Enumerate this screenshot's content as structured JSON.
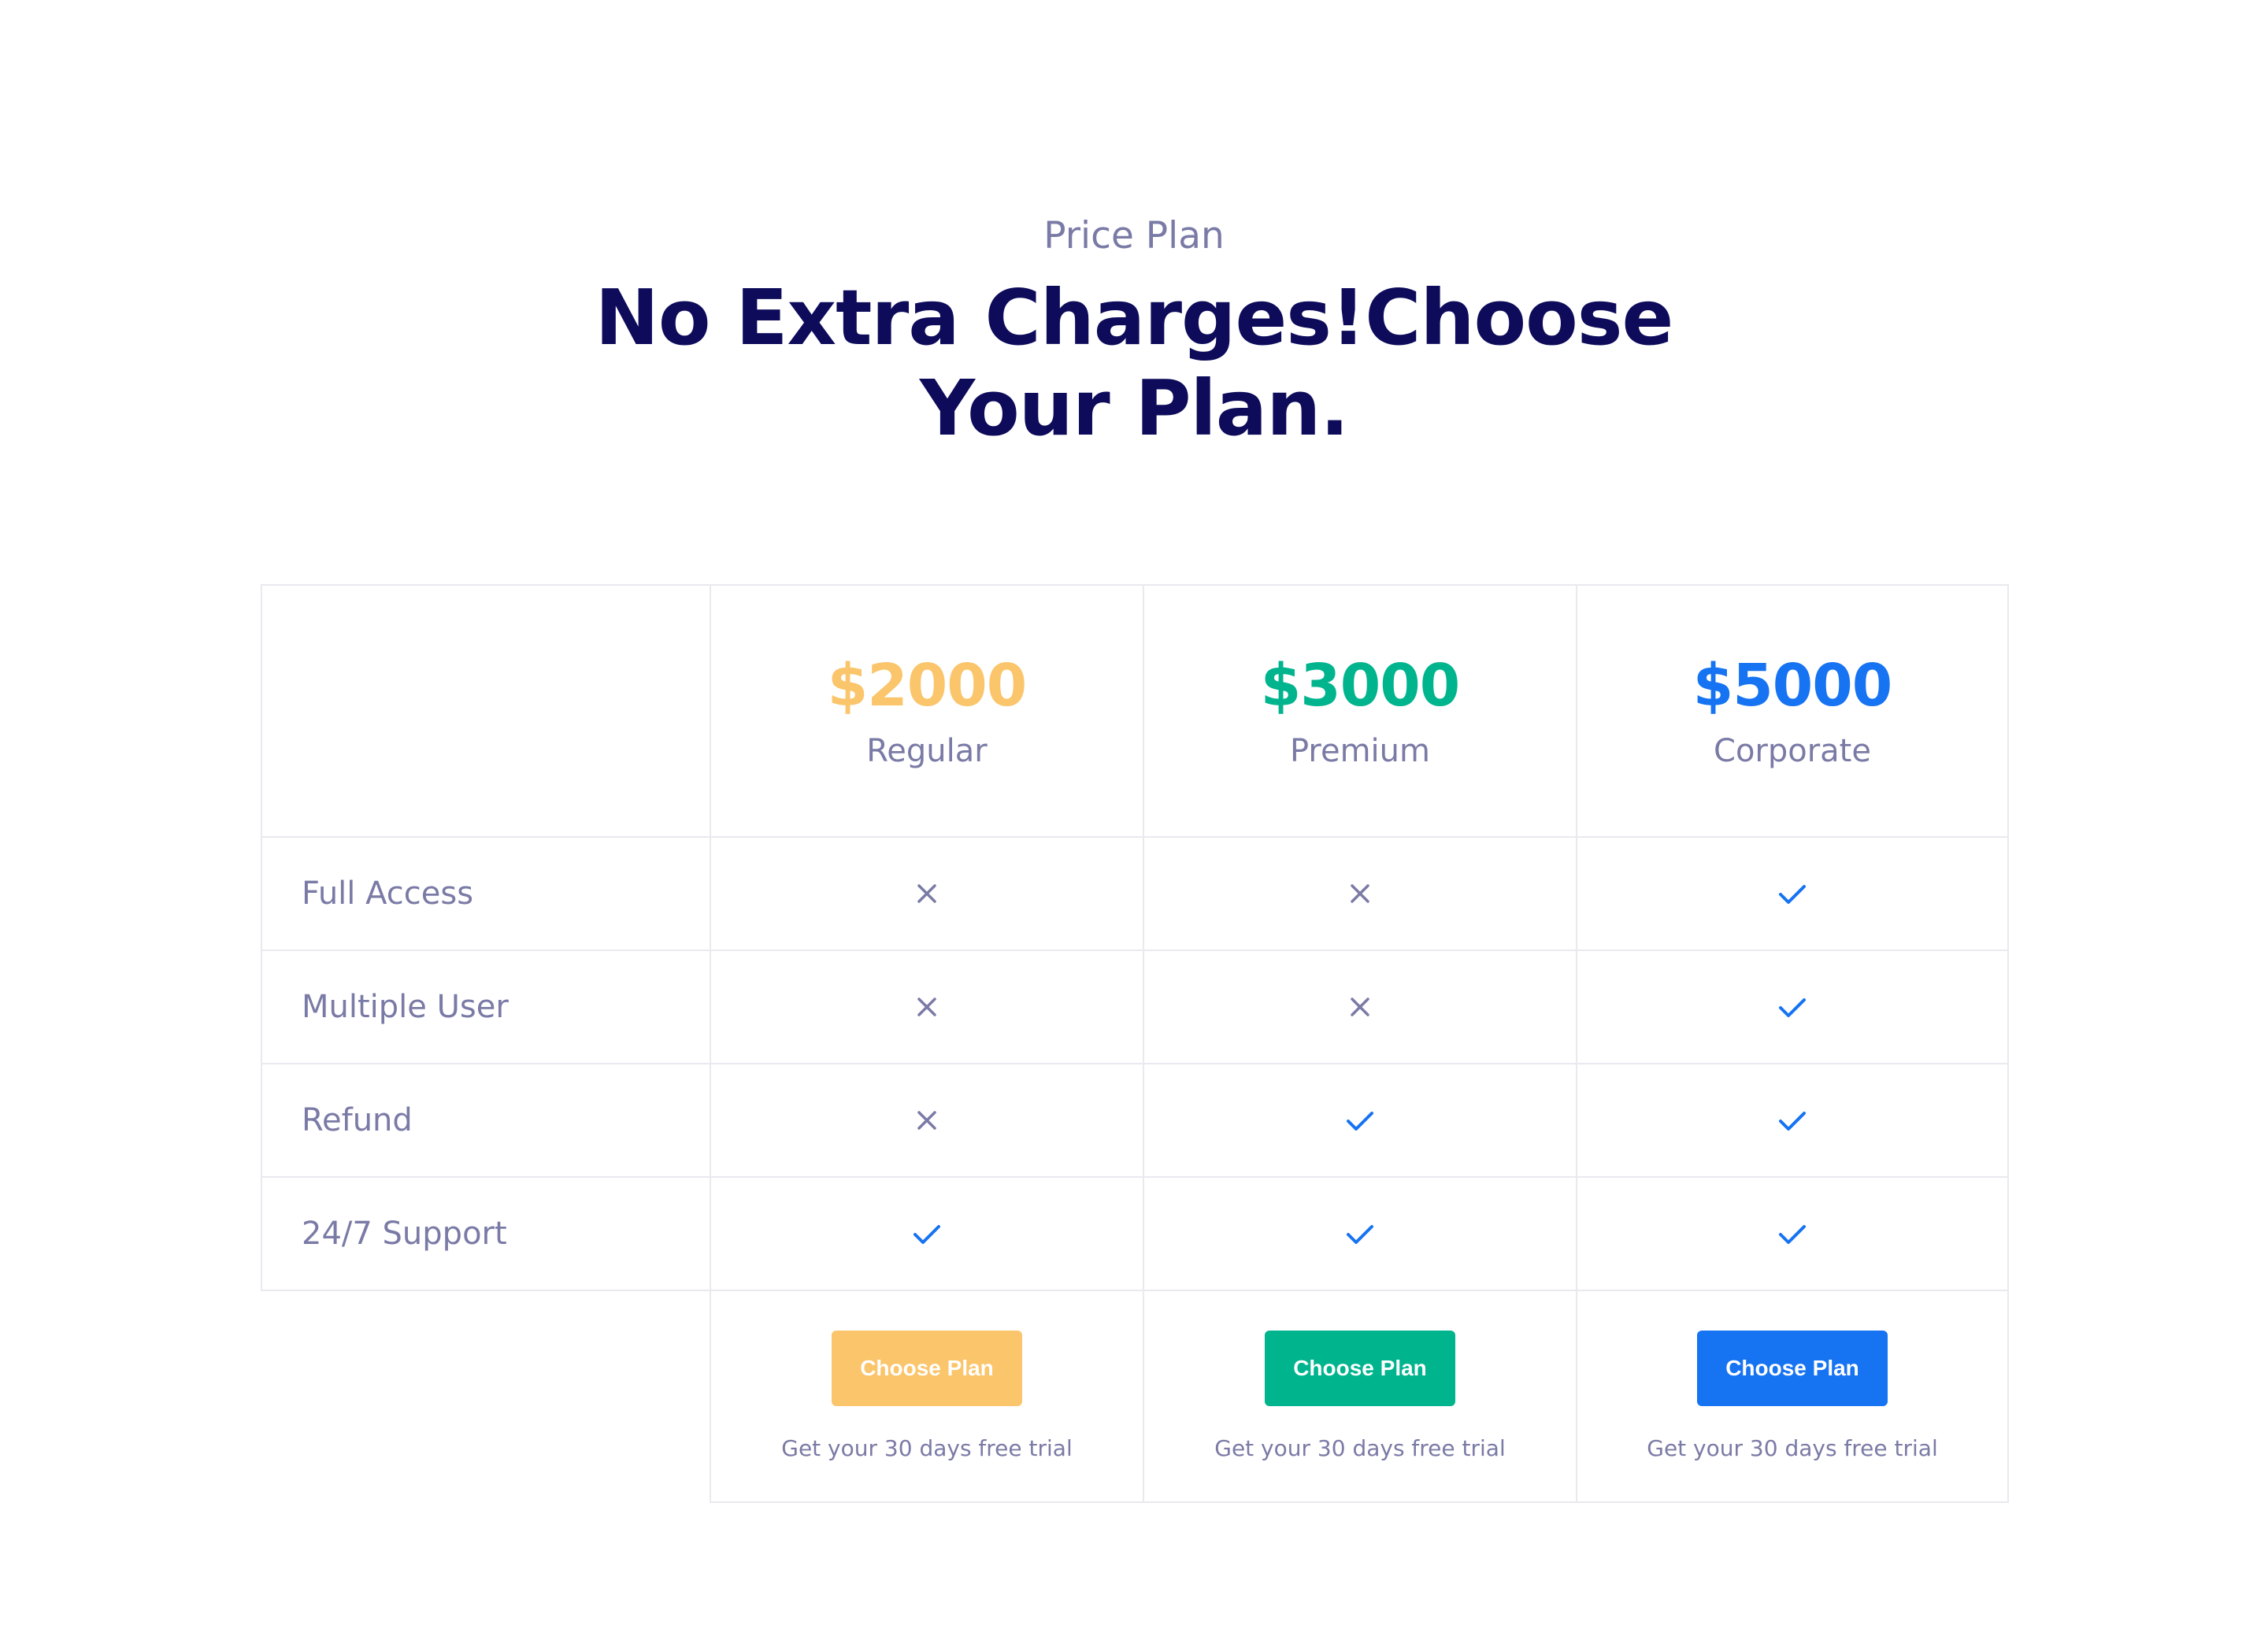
{
  "header": {
    "eyebrow": "Price Plan",
    "title_line1": "No Extra Charges!Choose",
    "title_line2": "Your Plan."
  },
  "plans": [
    {
      "price": "$2000",
      "name": "Regular",
      "color": "#fac56b",
      "features": [
        "cross",
        "cross",
        "cross",
        "check"
      ],
      "button_label": "Choose Plan",
      "trial_text": "Get your 30 days free trial"
    },
    {
      "price": "$3000",
      "name": "Premium",
      "color": "#00b48e",
      "features": [
        "cross",
        "cross",
        "check",
        "check"
      ],
      "button_label": "Choose Plan",
      "trial_text": "Get your 30 days free trial"
    },
    {
      "price": "$5000",
      "name": "Corporate",
      "color": "#1673f2",
      "features": [
        "check",
        "check",
        "check",
        "check"
      ],
      "button_label": "Choose Plan",
      "trial_text": "Get your 30 days free trial"
    }
  ],
  "features": [
    {
      "label": "Full Access"
    },
    {
      "label": "Multiple User"
    },
    {
      "label": "Refund"
    },
    {
      "label": "24/7 Support"
    }
  ],
  "icons": {
    "check": "check-icon",
    "cross": "cross-icon",
    "check_color": "#1673f2",
    "cross_color": "#7a7aa6"
  }
}
